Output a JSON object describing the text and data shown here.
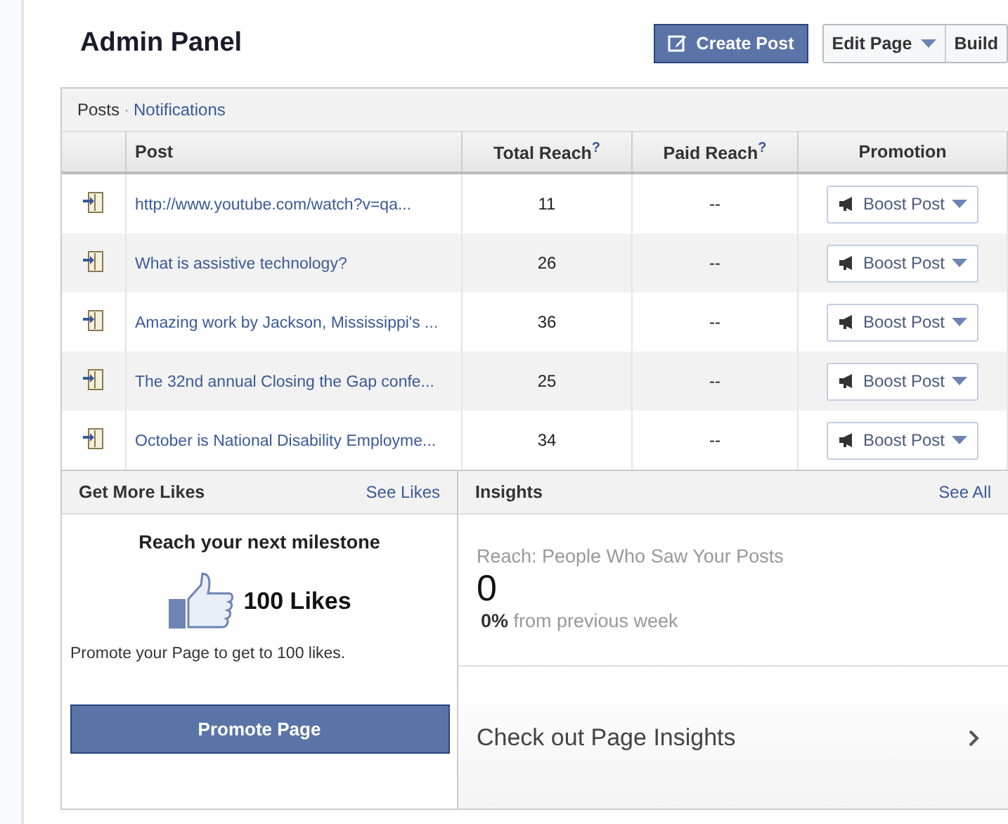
{
  "header": {
    "title": "Admin Panel",
    "create_button": "Create Post",
    "edit_button": "Edit Page",
    "build_button": "Build"
  },
  "posts_panel": {
    "tabs": [
      {
        "label": "Posts",
        "selected": true
      },
      {
        "label": "Notifications",
        "selected": false
      }
    ],
    "tab_separator": "·",
    "columns": [
      {
        "label": "Post"
      },
      {
        "label": "Total Reach",
        "help": "?"
      },
      {
        "label": "Paid Reach",
        "help": "?"
      },
      {
        "label": "Promotion"
      }
    ],
    "rows": [
      {
        "post": "http://www.youtube.com/watch?v=qa...",
        "total_reach": "11",
        "paid_reach": "--",
        "promotion": "Boost Post"
      },
      {
        "post": "What is assistive technology?",
        "total_reach": "26",
        "paid_reach": "--",
        "promotion": "Boost Post"
      },
      {
        "post": "Amazing work by Jackson, Mississippi's ...",
        "total_reach": "36",
        "paid_reach": "--",
        "promotion": "Boost Post"
      },
      {
        "post": "The 32nd annual Closing the Gap confe...",
        "total_reach": "25",
        "paid_reach": "--",
        "promotion": "Boost Post"
      },
      {
        "post": "October is National Disability Employme...",
        "total_reach": "34",
        "paid_reach": "--",
        "promotion": "Boost Post"
      }
    ]
  },
  "likes_panel": {
    "title": "Get More Likes",
    "link": "See Likes",
    "heading": "Reach your next milestone",
    "goal": "100 Likes",
    "text": "Promote your Page to get to 100 likes.",
    "button": "Promote Page"
  },
  "insights_panel": {
    "title": "Insights",
    "link": "See All",
    "metric_label": "Reach: People Who Saw Your Posts",
    "metric_value": "0",
    "change": "**0%** from previous week",
    "footer_link": "Check out Page Insights"
  }
}
